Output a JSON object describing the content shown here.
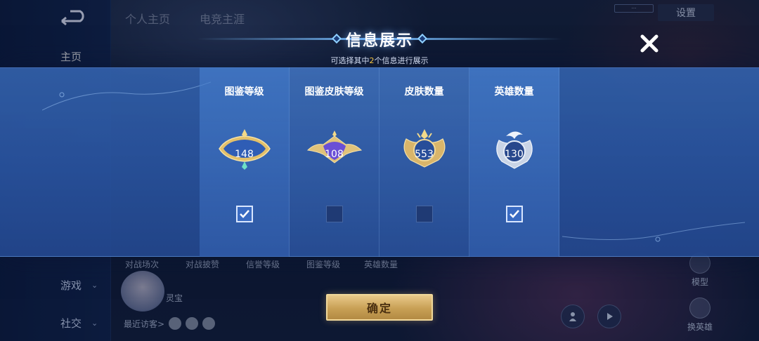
{
  "background": {
    "left_nav": {
      "items": [
        {
          "label": "主页",
          "chevron": false
        },
        {
          "label": "游戏",
          "chevron": true
        },
        {
          "label": "社交",
          "chevron": true
        }
      ]
    },
    "top_tabs": [
      "个人主页",
      "电竞主涯"
    ],
    "settings_label": "设置",
    "stats_labels": [
      "对战场次",
      "对战披赞",
      "信誉等级",
      "图鉴等级",
      "英雄数量"
    ],
    "profile_name": "灵宝",
    "recent_visitors_label": "最近访客>",
    "model_label": "模型",
    "swap_hero_label": "换英雄"
  },
  "modal": {
    "title": "信息展示",
    "subtitle_prefix": "可选择其中",
    "subtitle_count": "2",
    "subtitle_suffix": "个信息进行展示",
    "close_icon": "close-x-icon",
    "options": [
      {
        "label": "图鉴等级",
        "value": "148",
        "selected": true,
        "badge": "blue-gold-wing-badge"
      },
      {
        "label": "图鉴皮肤等级",
        "value": "108",
        "selected": false,
        "badge": "purple-gold-wing-badge"
      },
      {
        "label": "皮肤数量",
        "value": "553",
        "selected": false,
        "badge": "gold-crest-badge"
      },
      {
        "label": "英雄数量",
        "value": "130",
        "selected": true,
        "badge": "silver-crest-badge"
      }
    ],
    "confirm_label": "确定"
  },
  "colors": {
    "accent_gold": "#f4c542",
    "panel_blue": "#3a6bc2",
    "confirm_gold": "#c8a055"
  }
}
